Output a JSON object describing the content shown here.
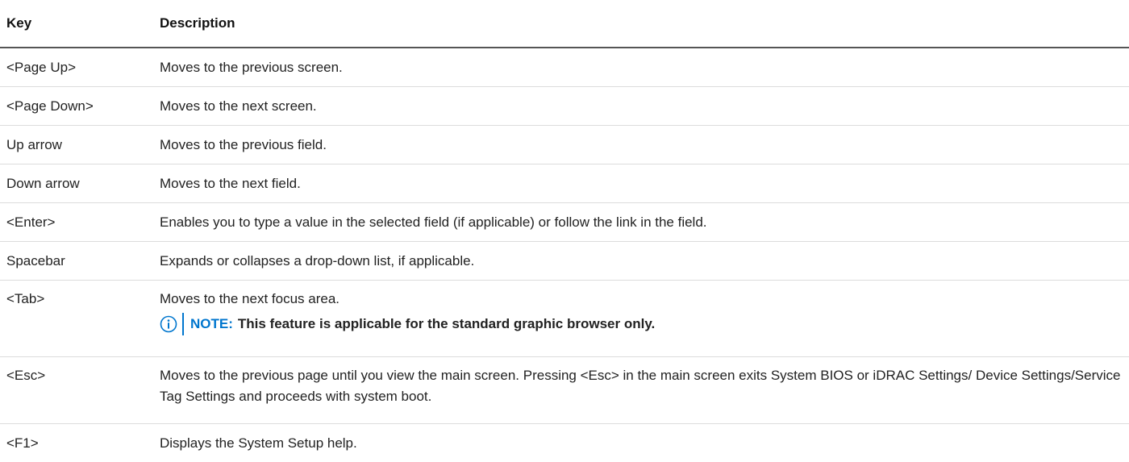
{
  "table": {
    "headers": {
      "key": "Key",
      "description": "Description"
    },
    "rows": [
      {
        "key": "<Page Up>",
        "description": "Moves to the previous screen."
      },
      {
        "key": "<Page Down>",
        "description": "Moves to the next screen."
      },
      {
        "key": "Up arrow",
        "description": "Moves to the previous field."
      },
      {
        "key": "Down arrow",
        "description": "Moves to the next field."
      },
      {
        "key": "<Enter>",
        "description": "Enables you to type a value in the selected field (if applicable) or follow the link in the field."
      },
      {
        "key": "Spacebar",
        "description": "Expands or collapses a drop-down list, if applicable."
      },
      {
        "key": "<Tab>",
        "description": "Moves to the next focus area.",
        "note_label": "NOTE:",
        "note_text": "This feature is applicable for the standard graphic browser only."
      },
      {
        "key": "<Esc>",
        "description": "Moves to the previous page until you view the main screen. Pressing <Esc> in the main screen exits System BIOS or iDRAC Settings/ Device Settings/Service Tag Settings and proceeds with system boot."
      },
      {
        "key": "<F1>",
        "description": "Displays the System Setup help."
      }
    ]
  },
  "colors": {
    "note_accent": "#0076ce",
    "text": "#222222"
  },
  "icons": {
    "note": "info-icon"
  }
}
